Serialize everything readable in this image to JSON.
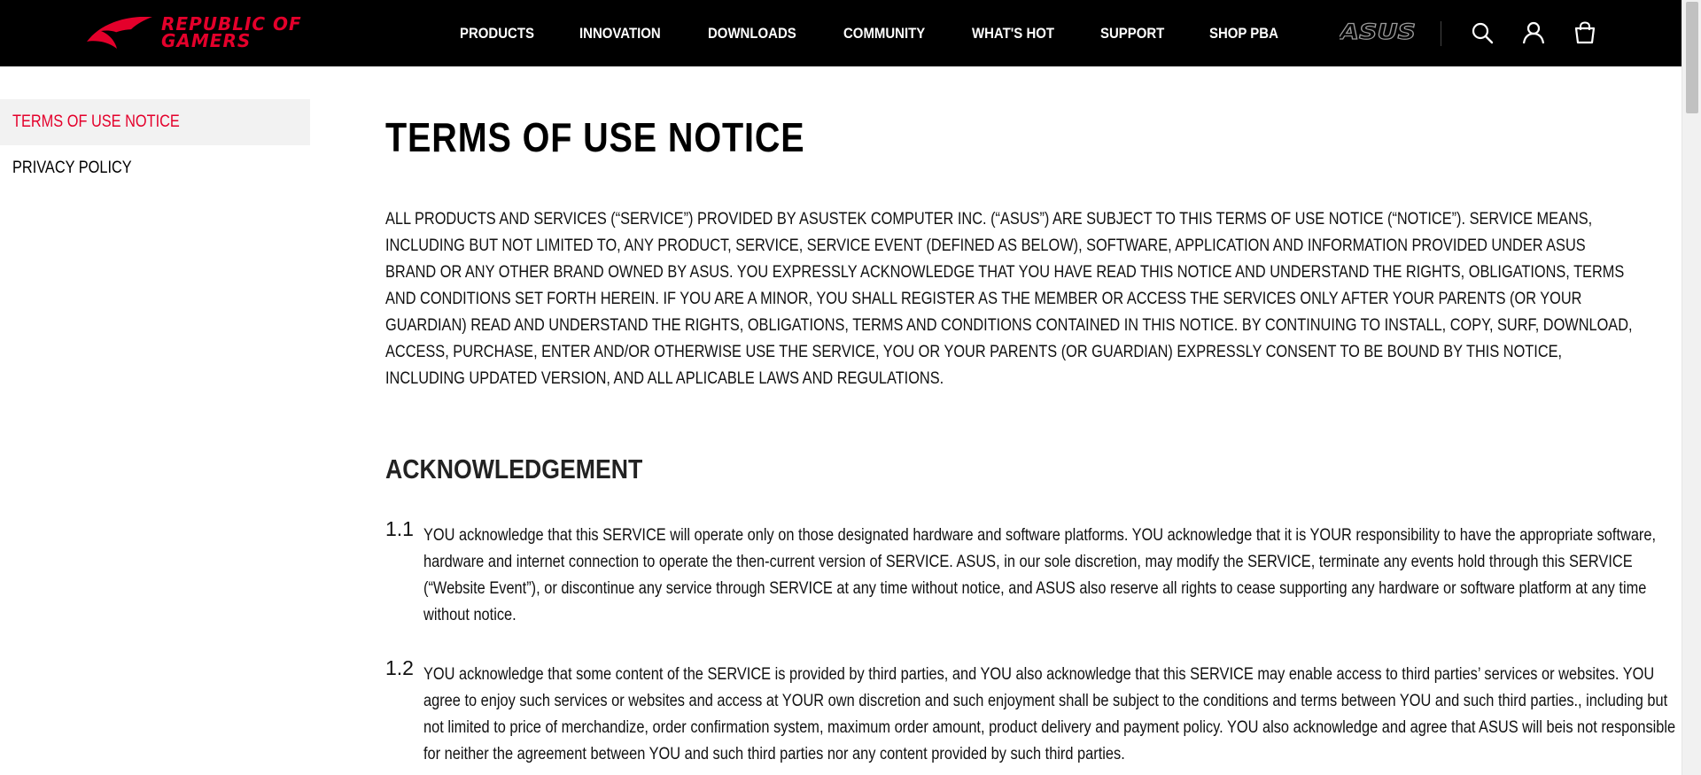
{
  "header": {
    "logo_line1": "REPUBLIC OF",
    "logo_line2": "GAMERS",
    "brand_logo": "ASUS",
    "nav": [
      "PRODUCTS",
      "INNOVATION",
      "DOWNLOADS",
      "COMMUNITY",
      "WHAT'S HOT",
      "SUPPORT",
      "SHOP PBA"
    ],
    "icons": [
      "search-icon",
      "user-icon",
      "cart-icon"
    ]
  },
  "sidebar": {
    "items": [
      {
        "label": "TERMS OF USE NOTICE",
        "active": true
      },
      {
        "label": "PRIVACY POLICY",
        "active": false
      }
    ]
  },
  "main": {
    "title": "TERMS OF USE NOTICE",
    "intro": "ALL PRODUCTS AND SERVICES (“SERVICE”) PROVIDED BY ASUSTEK COMPUTER INC. (“ASUS”) ARE SUBJECT TO THIS TERMS OF USE NOTICE (“NOTICE”). SERVICE MEANS, INCLUDING BUT NOT LIMITED TO, ANY PRODUCT, SERVICE, SERVICE EVENT (DEFINED AS BELOW), SOFTWARE, APPLICATION AND INFORMATION PROVIDED UNDER ASUS BRAND OR ANY OTHER BRAND OWNED BY ASUS. YOU EXPRESSLY ACKNOWLEDGE THAT YOU HAVE READ THIS NOTICE AND UNDERSTAND THE RIGHTS, OBLIGATIONS, TERMS AND CONDITIONS SET FORTH HEREIN. IF YOU ARE A MINOR, YOU SHALL REGISTER AS THE MEMBER OR ACCESS THE SERVICES ONLY AFTER YOUR PARENTS (OR YOUR GUARDIAN) READ AND UNDERSTAND THE RIGHTS, OBLIGATIONS, TERMS AND CONDITIONS CONTAINED IN THIS NOTICE. BY CONTINUING TO INSTALL, COPY, SURF, DOWNLOAD, ACCESS, PURCHASE, ENTER AND/OR OTHERWISE USE THE SERVICE, YOU OR YOUR PARENTS (OR GUARDIAN) EXPRESSLY CONSENT TO BE BOUND BY THIS NOTICE, INCLUDING UPDATED VERSION, AND ALL APLICABLE LAWS AND REGULATIONS.",
    "section_title": "ACKNOWLEDGEMENT",
    "clauses": [
      {
        "num": "1.1",
        "text": "YOU acknowledge that this SERVICE will operate only on those designated hardware and software platforms. YOU acknowledge that it is YOUR responsibility to have the appropriate software, hardware and internet connection to operate the then-current version of SERVICE. ASUS, in our sole discretion, may modify the SERVICE, terminate any events hold through this SERVICE (“Website Event”), or discontinue any service through SERVICE at any time without notice, and ASUS also reserve all rights to cease supporting any hardware or software platform at any time without notice."
      },
      {
        "num": "1.2",
        "text": "YOU acknowledge that some content of the SERVICE is provided by third parties, and YOU also acknowledge that this SERVICE may enable access to third parties’ services or websites. YOU agree to enjoy such services or websites and access at YOUR own discretion and such enjoyment shall be subject to the conditions and terms between YOU and such third parties., including but not limited to price of merchandize, order confirmation system, maximum order amount, product delivery and payment policy. YOU also acknowledge and agree that ASUS will beis not responsible for neither the agreement between YOU and such third parties nor any content provided by such third parties."
      }
    ]
  },
  "colors": {
    "brand_red": "#e4002b",
    "header_bg": "#000000",
    "active_bg": "#f2f2f2"
  }
}
